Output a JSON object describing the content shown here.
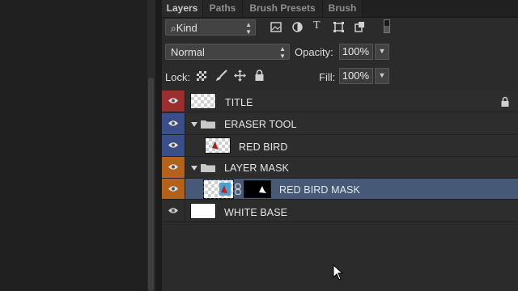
{
  "tabs": [
    "Layers",
    "Paths",
    "Brush Presets",
    "Brush"
  ],
  "filter": {
    "kind_label": "Kind"
  },
  "blend": {
    "mode": "Normal",
    "opacity_label": "Opacity:",
    "opacity_value": "100%"
  },
  "lock": {
    "label": "Lock:",
    "fill_label": "Fill:",
    "fill_value": "100%"
  },
  "colors": {
    "red": "#9b2f2f",
    "blue": "#3a4f8a",
    "orange": "#b4621a",
    "selected": "#465a78"
  },
  "layers": [
    {
      "name": "TITLE",
      "color": "red",
      "locked": true
    },
    {
      "name": "ERASER TOOL",
      "color": "blue",
      "group": true
    },
    {
      "name": "RED BIRD",
      "color": "blue"
    },
    {
      "name": "LAYER MASK",
      "color": "orange",
      "group": true
    },
    {
      "name": "RED BIRD MASK",
      "color": "orange",
      "selected": true
    },
    {
      "name": "WHITE BASE",
      "color": "none"
    }
  ]
}
